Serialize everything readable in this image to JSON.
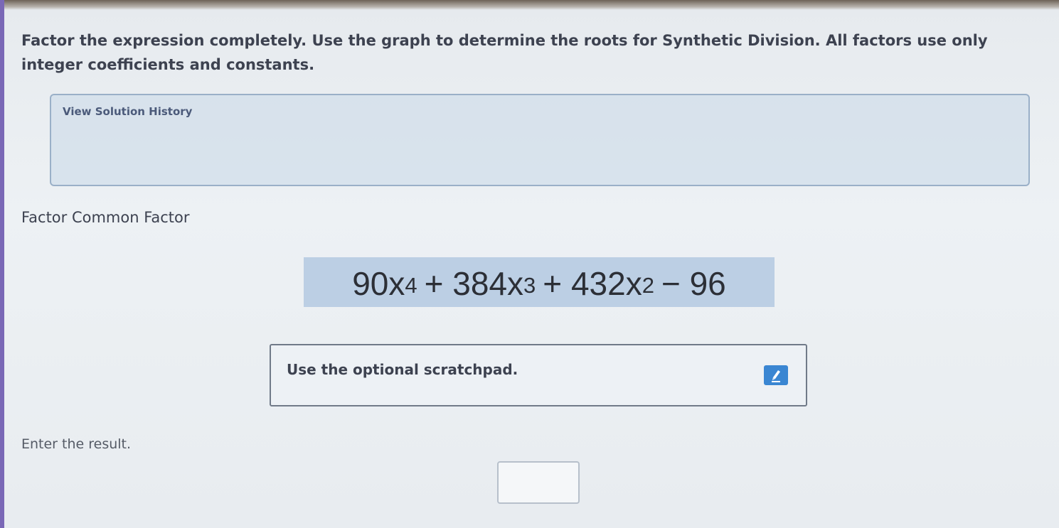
{
  "instructions": {
    "text": "Factor the expression completely. Use the graph to determine the roots for Synthetic Division. All factors use only integer coefficients and constants."
  },
  "history": {
    "link_label": "View Solution History"
  },
  "step": {
    "title": "Factor Common Factor"
  },
  "expression": {
    "term1_coef": "90x",
    "term1_exp": "4",
    "term2_coef": "+ 384x",
    "term2_exp": "3",
    "term3_coef": "+ 432x",
    "term3_exp": "2",
    "term4": "− 96"
  },
  "scratchpad": {
    "label": "Use the optional scratchpad.",
    "icon": "pencil-icon"
  },
  "answer": {
    "prompt": "Enter the result.",
    "value": ""
  },
  "colors": {
    "expression_highlight": "#bccfe4",
    "pencil_button": "#3a86d2",
    "history_box": "#c8d8e8"
  }
}
